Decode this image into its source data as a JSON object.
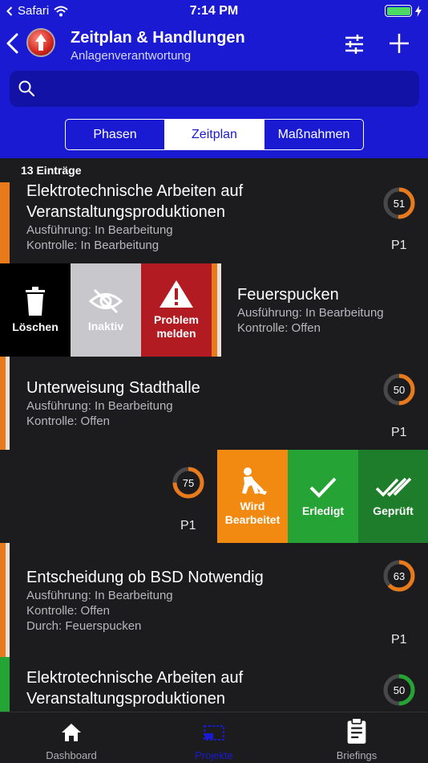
{
  "status": {
    "carrier": "Safari",
    "time": "7:14 PM"
  },
  "nav": {
    "title": "Zeitplan & Handlungen",
    "subtitle": "Anlagenverantwortung"
  },
  "search": {
    "placeholder": ""
  },
  "segments": [
    {
      "label": "Phasen",
      "active": false
    },
    {
      "label": "Zeitplan",
      "active": true
    },
    {
      "label": "Maßnahmen",
      "active": false
    }
  ],
  "list": {
    "count_label": "13 Einträge",
    "rows": [
      {
        "title_line1": "Elektrotechnische Arbeiten auf",
        "title_line2": "Veranstaltungsproduktionen",
        "execution": "Ausführung: In Bearbeitung",
        "control": "Kontrolle: In Bearbeitung",
        "progress": 51,
        "priority": "P1",
        "stripe_color": "#e87a1c"
      },
      {
        "title": "Feuerspucken",
        "execution": "Ausführung: In Bearbeitung",
        "control": "Kontrolle: Offen",
        "stripe_color": "#e87a1c",
        "actions": [
          {
            "label": "Löschen",
            "icon": "trash-icon",
            "color": "#000000"
          },
          {
            "label": "Inaktiv",
            "icon": "eye-off-icon",
            "color": "#c7c7cc"
          },
          {
            "label_line1": "Problem",
            "label_line2": "melden",
            "icon": "warning-icon",
            "color": "#b31b22"
          }
        ]
      },
      {
        "title": "Unterweisung Stadthalle",
        "execution": "Ausführung: In Bearbeitung",
        "control": "Kontrolle: Offen",
        "progress": 50,
        "priority": "P1",
        "stripe_color": "#e87a1c"
      },
      {
        "progress": 75,
        "priority": "P1",
        "actions": [
          {
            "label_line1": "Wird",
            "label_line2": "Bearbeitet",
            "icon": "worker-icon",
            "color": "#f28a12"
          },
          {
            "label": "Erledigt",
            "icon": "check-icon",
            "color": "#26a335"
          },
          {
            "label": "Geprüft",
            "icon": "double-check-icon",
            "color": "#1e7d2a"
          }
        ]
      },
      {
        "title": "Entscheidung ob BSD Notwendig",
        "execution": "Ausführung: In Bearbeitung",
        "control": "Kontrolle: Offen",
        "by": "Durch: Feuerspucken",
        "progress": 63,
        "priority": "P1",
        "stripe_color": "#e87a1c"
      },
      {
        "title_line1": "Elektrotechnische Arbeiten auf",
        "title_line2": "Veranstaltungsproduktionen",
        "progress": 50,
        "stripe_color": "#26a335",
        "ring_color": "#26a335"
      }
    ]
  },
  "tabbar": {
    "items": [
      {
        "label": "Dashboard",
        "icon": "home-icon",
        "active": false
      },
      {
        "label": "Projekte",
        "icon": "projects-icon",
        "active": true
      },
      {
        "label": "Briefings",
        "icon": "clipboard-icon",
        "active": false
      }
    ]
  },
  "colors": {
    "header_bg": "#1a1ad2",
    "search_bg": "#1212a6",
    "progress_orange": "#e87a1c",
    "progress_green": "#26a335",
    "tab_active": "#1a1ad2"
  }
}
